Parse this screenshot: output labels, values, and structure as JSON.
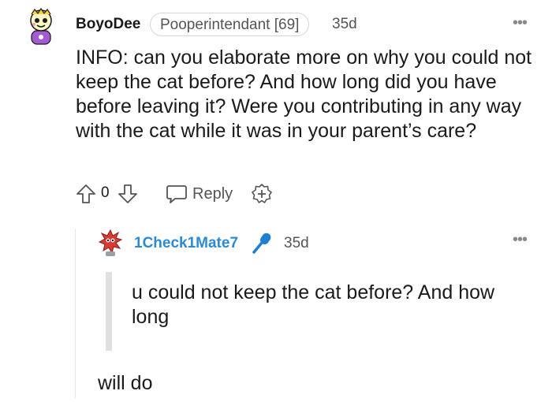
{
  "comment": {
    "username": "BoyoDee",
    "flair": "Pooperintendant [69]",
    "age": "35d",
    "body": "INFO: can you elaborate more on why you could not keep the cat before? And how long did you have before leaving it? Were you contributing in any way with the cat while it was in your parent’s care?",
    "votes": "0",
    "reply_label": "Reply"
  },
  "reply": {
    "username": "1Check1Mate7",
    "age": "35d",
    "quote": "u could not keep the cat before? And how long",
    "body": "will do"
  },
  "colors": {
    "reply_username": "#2a8ad6",
    "mic_icon": "#1e7fd0",
    "text": "#1a1a1b",
    "muted": "#555555"
  },
  "icons": [
    "avatar-snoo-icon",
    "upvote-icon",
    "downvote-icon",
    "reply-bubble-icon",
    "award-plus-icon",
    "more-options-icon",
    "microphone-icon",
    "avatar-spiky-icon"
  ]
}
